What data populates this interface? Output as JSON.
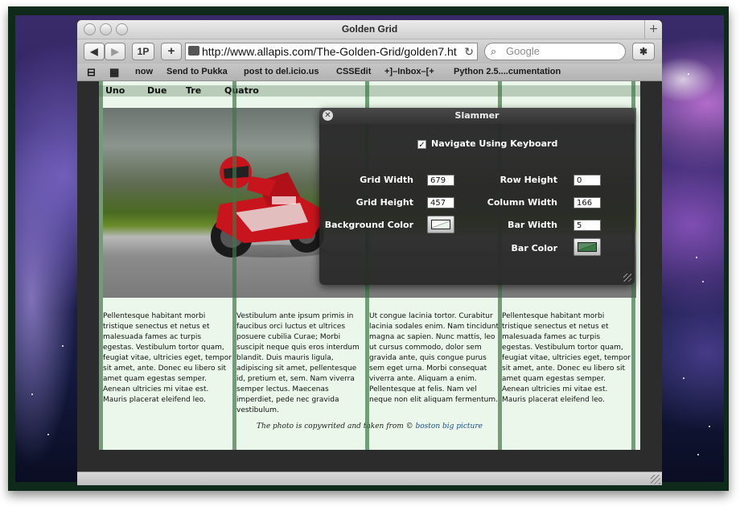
{
  "window": {
    "title": "Golden Grid",
    "new_tab_symbol": "+"
  },
  "toolbar": {
    "back_symbol": "◀",
    "forward_symbol": "▶",
    "onepassword_label": "1P",
    "add_symbol": "+",
    "url": "http://www.allapis.com/The-Golden-Grid/golden7.ht",
    "reload_symbol": "↻",
    "search_placeholder": "Google",
    "search_symbol": "⌕",
    "bug_symbol": "✱"
  },
  "bookmarks": {
    "book_symbol": "⊟",
    "grid_symbol": "▦",
    "items": [
      "now",
      "Send to Pukka",
      "post to del.icio.us",
      "CSSEdit",
      "+]–Inbox–[+",
      "Python 2.5....cumentation"
    ]
  },
  "page": {
    "nav": [
      "Uno",
      "Due",
      "Tre",
      "Quatro"
    ],
    "columns": [
      "Pellentesque habitant morbi tristique senectus et netus et malesuada fames ac turpis egestas. Vestibulum tortor quam, feugiat vitae, ultricies eget, tempor sit amet, ante. Donec eu libero sit amet quam egestas semper. Aenean ultricies mi vitae est. Mauris placerat eleifend leo.",
      "Vestibulum ante ipsum primis in faucibus orci luctus et ultrices posuere cubilia Curae; Morbi suscipit neque quis eros interdum blandit. Duis mauris ligula, adipiscing sit amet, pellentesque id, pretium et, sem. Nam viverra semper lectus. Maecenas imperdiet, pede nec gravida vestibulum.",
      "Ut congue lacinia tortor. Curabitur lacinia sodales enim. Nam tincidunt magna ac sapien. Nunc mattis, leo ut cursus commodo, dolor sem gravida ante, quis congue purus sem eget urna. Morbi consequat viverra ante. Aliquam a enim. Pellentesque at felis. Nam vel neque non elit aliquam fermentum.",
      "Pellentesque habitant morbi tristique senectus et netus et malesuada fames ac turpis egestas. Vestibulum tortor quam, feugiat vitae, ultricies eget, tempor sit amet, ante. Donec eu libero sit amet quam egestas semper. Aenean ultricies mi vitae est. Mauris placerat eleifend leo."
    ],
    "caption_text": "The photo is copywrited and taken from © ",
    "caption_link": "boston big picture"
  },
  "slammer": {
    "title": "Slammer",
    "close_symbol": "✕",
    "navigate_label": "Navigate Using Keyboard",
    "navigate_checked": "✓",
    "grid_width_label": "Grid Width",
    "grid_width": "679",
    "grid_height_label": "Grid Height",
    "grid_height": "457",
    "background_color_label": "Background Color",
    "row_height_label": "Row Height",
    "row_height": "0",
    "column_width_label": "Column Width",
    "column_width": "166",
    "bar_width_label": "Bar Width",
    "bar_width": "5",
    "bar_color_label": "Bar Color"
  },
  "colors": {
    "page_background": "#eaf7ea",
    "grid_bar": "#3c7846",
    "hud_background": "#282828",
    "link": "#1a4d8a"
  }
}
